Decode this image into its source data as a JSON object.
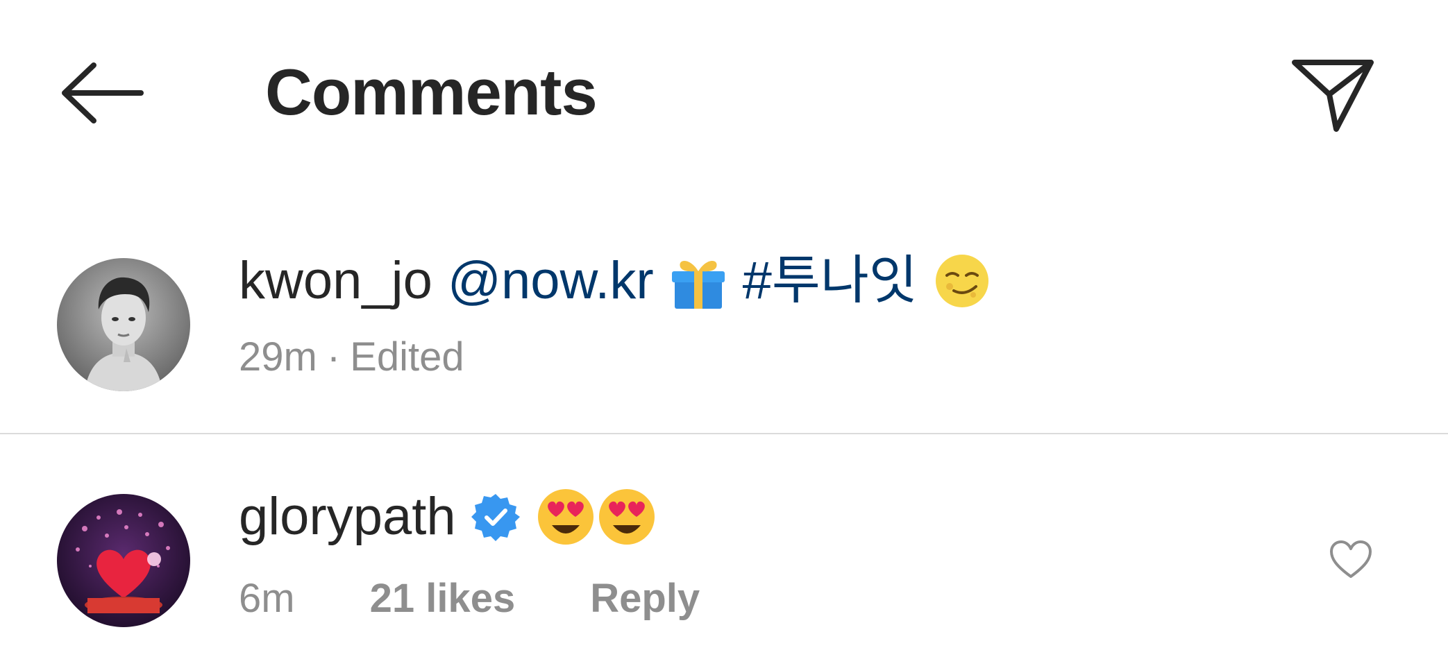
{
  "header": {
    "title": "Comments",
    "back_icon": "arrow-left-icon",
    "share_icon": "paper-plane-icon"
  },
  "caption": {
    "username": "kwon_jo",
    "mention": "@now.kr",
    "hashtag": "#투나잇",
    "emojis": [
      "gift-emoji",
      "smirk-emoji"
    ],
    "time": "29m",
    "separator": "·",
    "edited": "Edited"
  },
  "comments": [
    {
      "username": "glorypath",
      "verified": true,
      "emojis": [
        "heart-eyes-emoji",
        "heart-eyes-emoji"
      ],
      "time": "6m",
      "likes": "21 likes",
      "reply": "Reply"
    }
  ],
  "colors": {
    "text": "#262626",
    "muted": "#8e8e8e",
    "link": "#00376b",
    "verified": "#3897f0",
    "divider": "#dbdbdb"
  }
}
